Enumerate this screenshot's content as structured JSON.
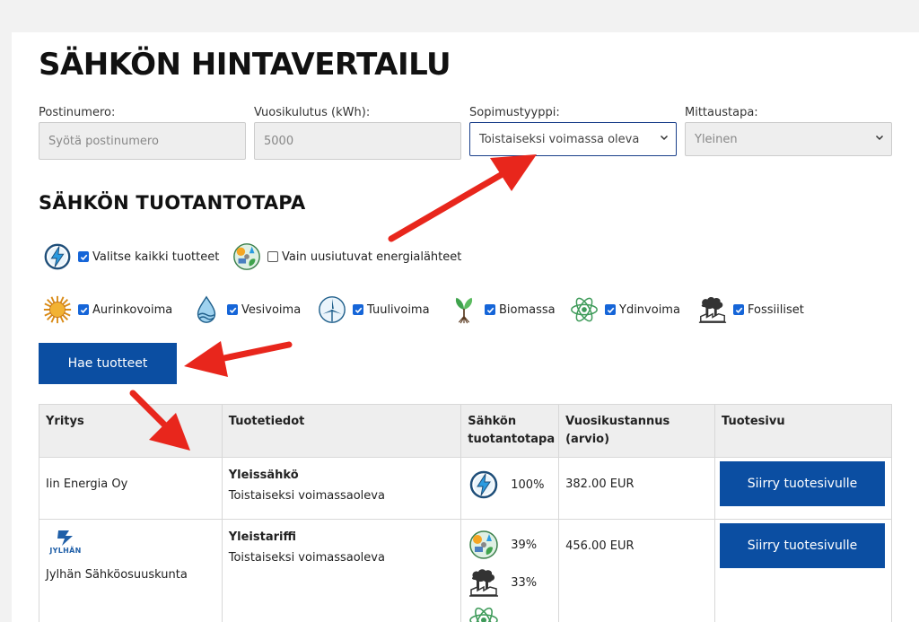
{
  "page": {
    "title": "SÄHKÖN HINTAVERTAILU",
    "section_title": "SÄHKÖN TUOTANTOTAPA"
  },
  "form": {
    "postinumero": {
      "label": "Postinumero:",
      "placeholder": "Syötä postinumero"
    },
    "vuosikulutus": {
      "label": "Vuosikulutus (kWh):",
      "value": "5000"
    },
    "sopimustyyppi": {
      "label": "Sopimustyyppi:",
      "selected": "Toistaiseksi voimassa oleva"
    },
    "mittaustapa": {
      "label": "Mittaustapa:",
      "selected": "Yleinen"
    }
  },
  "filters": {
    "select_all": {
      "label": "Valitse kaikki tuotteet",
      "checked": true,
      "icon": "lightning-icon"
    },
    "renewable_only": {
      "label": "Vain uusiutuvat energialähteet",
      "checked": false,
      "icon": "renewable-mix-icon"
    },
    "sources": [
      {
        "label": "Aurinkovoima",
        "checked": true,
        "icon": "sun-icon"
      },
      {
        "label": "Vesivoima",
        "checked": true,
        "icon": "water-drop-icon"
      },
      {
        "label": "Tuulivoima",
        "checked": true,
        "icon": "wind-turbine-icon"
      },
      {
        "label": "Biomassa",
        "checked": true,
        "icon": "plant-icon"
      },
      {
        "label": "Ydinvoima",
        "checked": true,
        "icon": "atom-icon"
      },
      {
        "label": "Fossiiliset",
        "checked": true,
        "icon": "factory-icon"
      }
    ]
  },
  "search_button": "Hae tuotteet",
  "table": {
    "headers": [
      "Yritys",
      "Tuotetiedot",
      "Sähkön tuotantotapa",
      "Vuosikustannus (arvio)",
      "Tuotesivu"
    ],
    "rows": [
      {
        "company": "Iin Energia Oy",
        "product": "Yleissähkö",
        "type": "Toistaiseksi voimassaoleva",
        "sources": [
          {
            "icon": "lightning-icon",
            "percent": "100%"
          }
        ],
        "cost": "382.00 EUR",
        "button": "Siirry tuotesivulle"
      },
      {
        "company": "Jylhän Sähköosuuskunta",
        "logo_text": "JYLHÄN",
        "product": "Yleistariffi",
        "type": "Toistaiseksi voimassaoleva",
        "sources": [
          {
            "icon": "renewable-mix-icon",
            "percent": "39%"
          },
          {
            "icon": "factory-icon",
            "percent": "33%"
          },
          {
            "icon": "atom-icon",
            "percent": ""
          }
        ],
        "cost": "456.00 EUR",
        "button": "Siirry tuotesivulle"
      }
    ]
  },
  "colors": {
    "primary": "#0b4ea2",
    "checkbox": "#1565d8",
    "arrow": "#e8261c"
  }
}
